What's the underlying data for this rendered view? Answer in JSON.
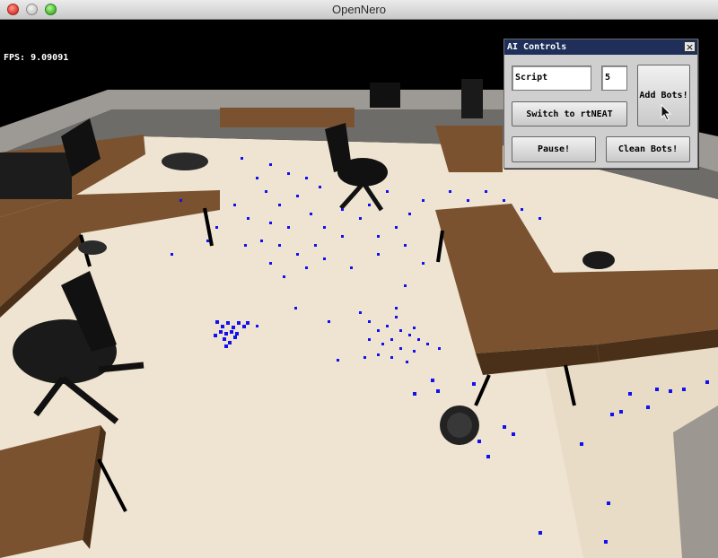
{
  "window": {
    "title": "OpenNero"
  },
  "hud": {
    "fps": "FPS: 9.09091"
  },
  "ai_controls": {
    "title": "AI Controls",
    "close_glyph": "×",
    "script_value": "Script",
    "count_value": "5",
    "switch_label": "Switch to rtNEAT",
    "add_label": "Add Bots!",
    "pause_label": "Pause!",
    "clean_label": "Clean Bots!"
  },
  "colors": {
    "floor": "#efe4d1",
    "desk": "#7a5230",
    "bot": "#1010f0",
    "panel_title": "#1f2f5a"
  }
}
